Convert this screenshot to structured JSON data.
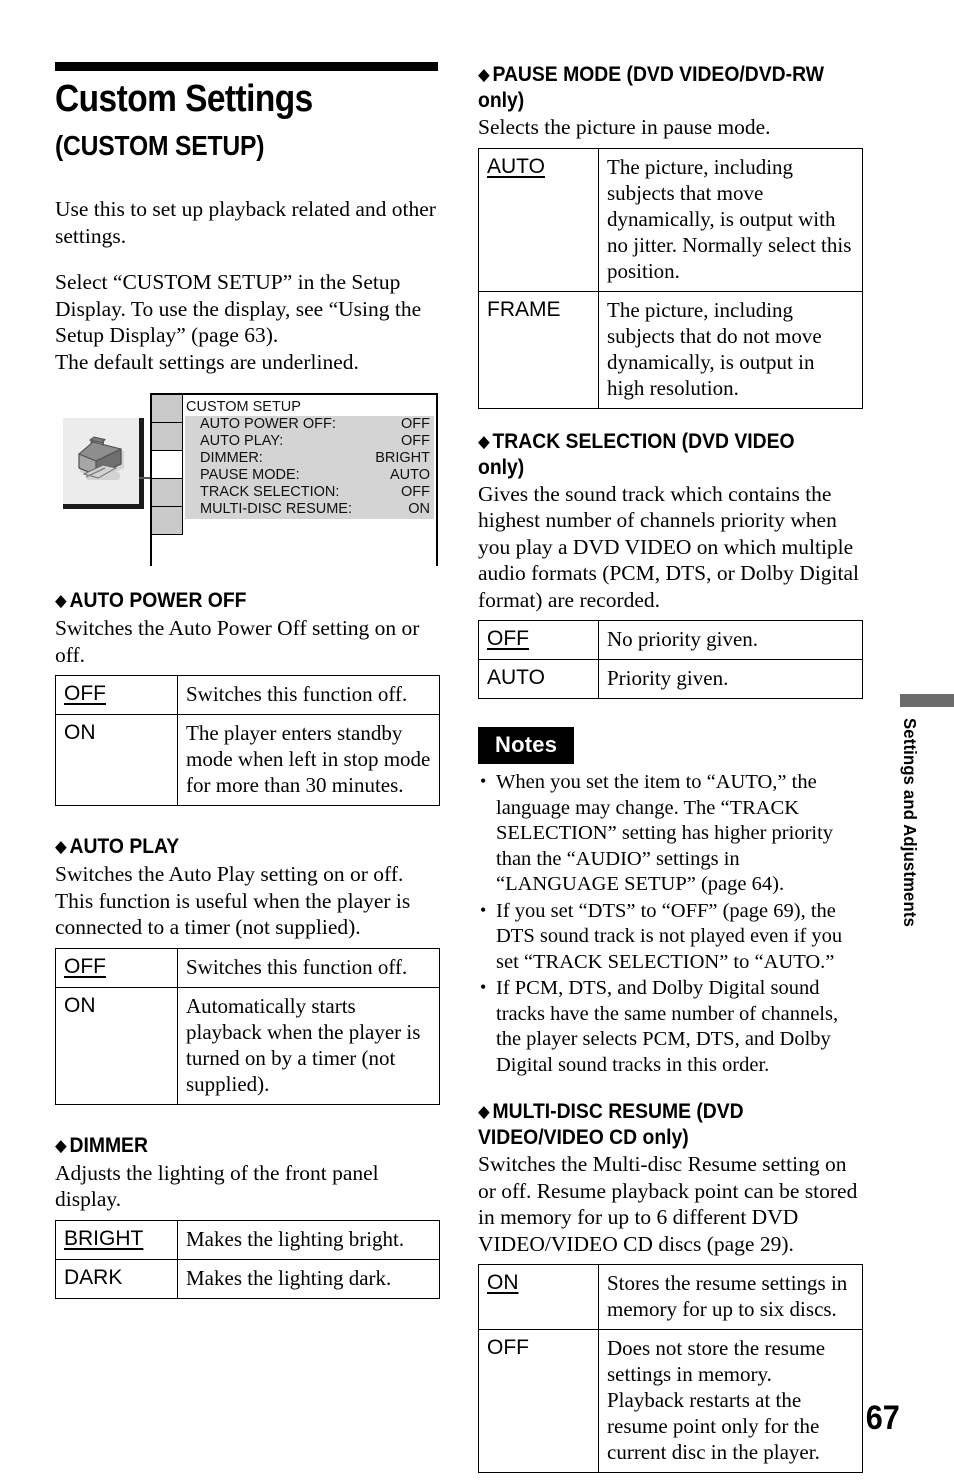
{
  "page": {
    "folio": "67",
    "side_tab_label": "Settings and Adjustments"
  },
  "title": {
    "main": "Custom Settings ",
    "sub": "(CUSTOM SETUP)"
  },
  "intro": {
    "p1": "Use this to set up playback related and other settings.",
    "p2": "Select “CUSTOM SETUP” in the Setup Display. To use the display, see “Using the Setup Display” (page 63).",
    "p3": "The default settings are underlined."
  },
  "setup_display": {
    "icon_name": "toolbox-icon",
    "title": "CUSTOM SETUP",
    "rows": [
      {
        "label": "AUTO POWER OFF:",
        "value": "OFF"
      },
      {
        "label": "AUTO PLAY:",
        "value": "OFF"
      },
      {
        "label": "DIMMER:",
        "value": "BRIGHT"
      },
      {
        "label": "PAUSE MODE:",
        "value": "AUTO"
      },
      {
        "label": "TRACK SELECTION:",
        "value": "OFF"
      },
      {
        "label": "MULTI-DISC RESUME:",
        "value": "ON"
      }
    ],
    "tab_count": 5,
    "selected_tab_index": 3
  },
  "sections": {
    "auto_power_off": {
      "heading": "AUTO POWER OFF",
      "description": "Switches the Auto Power Off setting on or off.",
      "rows": [
        {
          "key": "OFF",
          "value": "Switches this function off."
        },
        {
          "key": "ON",
          "value": "The player enters standby mode when left in stop mode for more than 30 minutes."
        }
      ]
    },
    "auto_play": {
      "heading": "AUTO PLAY",
      "description": "Switches the Auto Play setting on or off. This function is useful when the player is connected to a timer (not supplied).",
      "rows": [
        {
          "key": "OFF",
          "value": "Switches this function off."
        },
        {
          "key": "ON",
          "value": "Automatically starts playback when the player is turned on by a timer (not supplied)."
        }
      ]
    },
    "dimmer": {
      "heading": "DIMMER",
      "description": "Adjusts the lighting of the front panel display.",
      "rows": [
        {
          "key": "BRIGHT",
          "value": "Makes the lighting bright."
        },
        {
          "key": "DARK",
          "value": "Makes the lighting dark."
        }
      ]
    },
    "pause_mode": {
      "heading": "PAUSE MODE (DVD VIDEO/DVD-RW only)",
      "description": "Selects the picture in pause mode.",
      "rows": [
        {
          "key": "AUTO",
          "value": "The picture, including subjects that move dynamically, is output with no jitter. Normally select this position."
        },
        {
          "key": "FRAME",
          "value": "The picture, including subjects that do not move dynamically, is output in high resolution."
        }
      ]
    },
    "track_selection": {
      "heading": "TRACK SELECTION (DVD VIDEO only)",
      "description": "Gives the sound track which contains the highest number of channels priority when you play a DVD VIDEO on which multiple audio formats (PCM, DTS, or Dolby Digital format) are recorded.",
      "rows": [
        {
          "key": "OFF",
          "value": "No priority given."
        },
        {
          "key": "AUTO",
          "value": "Priority given."
        }
      ]
    },
    "multi_disc_resume": {
      "heading": "MULTI-DISC RESUME (DVD VIDEO/VIDEO CD only)",
      "description": "Switches the Multi-disc Resume setting on or off. Resume playback point can be stored in memory for up to 6 different DVD VIDEO/VIDEO CD discs (page 29).",
      "rows": [
        {
          "key": "ON",
          "value": "Stores the resume settings in memory for up to six discs."
        },
        {
          "key": "OFF",
          "value": "Does not store the resume settings in memory. Playback restarts at the resume point only for the current disc in the player."
        }
      ]
    }
  },
  "notes": {
    "badge": "Notes",
    "items": [
      "When you set the item to “AUTO,” the language may change. The “TRACK SELECTION” setting has higher priority than the “AUDIO” settings in “LANGUAGE SETUP” (page 64).",
      "If you set “DTS” to “OFF” (page 69), the DTS sound track is not played even if you set “TRACK SELECTION” to “AUTO.”",
      "If PCM, DTS, and Dolby Digital sound tracks have the same number of channels, the player selects PCM, DTS, and Dolby Digital sound tracks in this order."
    ]
  }
}
